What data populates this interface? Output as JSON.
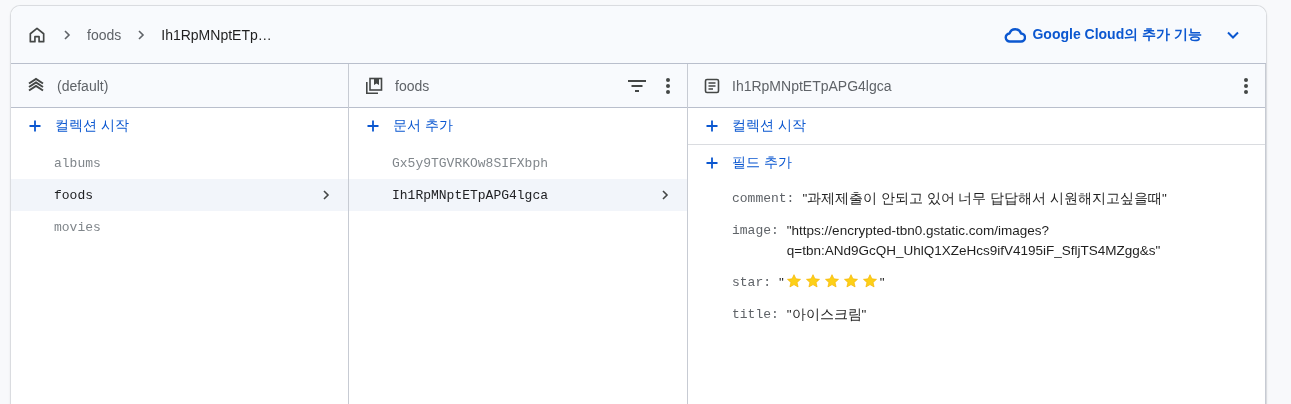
{
  "breadcrumb": [
    {
      "label": "foods"
    },
    {
      "label": "Ih1RpMNptETp…"
    }
  ],
  "cloud_button": {
    "label": "Google Cloud의 추가 기능"
  },
  "columns": [
    {
      "kind": "database",
      "title": "(default)",
      "filter_icon": false,
      "menu_icon": false,
      "actions": [
        "컬렉션 시작"
      ],
      "items": [
        {
          "label": "albums",
          "selected": false
        },
        {
          "label": "foods",
          "selected": true
        },
        {
          "label": "movies",
          "selected": false
        }
      ]
    },
    {
      "kind": "collection",
      "title": "foods",
      "filter_icon": true,
      "menu_icon": true,
      "actions": [
        "문서 추가"
      ],
      "items": [
        {
          "label": "Gx5y9TGVRKOw8SIFXbph",
          "selected": false
        },
        {
          "label": "Ih1RpMNptETpAPG4lgca",
          "selected": true
        }
      ]
    },
    {
      "kind": "document",
      "title": "Ih1RpMNptETpAPG4lgca",
      "filter_icon": false,
      "menu_icon": true,
      "actions": [
        "컬렉션 시작",
        "필드 추가"
      ],
      "fields": [
        {
          "kind": "string",
          "key": "comment:",
          "lines": [
            "\"과제제출이 안되고 있어 너무 답답해서 시원해지고싶을때\""
          ]
        },
        {
          "kind": "string",
          "key": "image:",
          "lines": [
            "\"https://encrypted-tbn0.gstatic.com/images?",
            "q=tbn:ANd9GcQH_UhlQ1XZeHcs9ifV4195iF_SfljTS4MZgg&s\""
          ]
        },
        {
          "kind": "stars",
          "key": "star:",
          "open_quote": "\"",
          "stars": 5,
          "close_quote": "\""
        },
        {
          "kind": "string",
          "key": "title:",
          "lines": [
            "\"아이스크림\""
          ]
        }
      ]
    }
  ]
}
